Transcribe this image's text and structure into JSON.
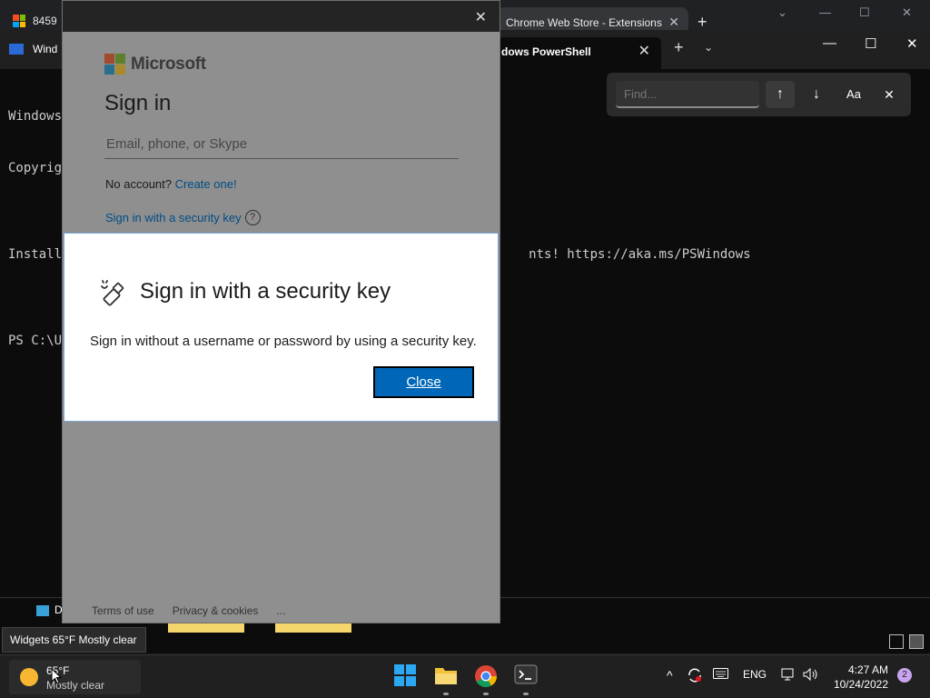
{
  "chrome": {
    "left_tab_text": "8459",
    "right_tab_title": "Chrome Web Store - Extensions",
    "close": "✕",
    "new_tab": "+",
    "ctl_down": "⌄",
    "ctl_min": "—",
    "ctl_max": "☐",
    "ctl_close": "✕"
  },
  "terminal": {
    "left_tab": "Wind",
    "active_tab": "dows PowerShell",
    "tab_close": "✕",
    "new_tab": "+",
    "dropdown": "⌄",
    "win_min": "—",
    "win_max": "☐",
    "win_close": "✕",
    "lines": [
      "Windows",
      "Copyrig",
      "",
      "Install                                                             nts! https://aka.ms/PSWindows",
      "",
      "PS C:\\U"
    ],
    "find": {
      "placeholder": "Find...",
      "up": "↑",
      "down": "↓",
      "case": "Aa",
      "close": "✕"
    },
    "bottom_item": "D"
  },
  "signin": {
    "brand": "Microsoft",
    "heading": "Sign in",
    "email_placeholder": "Email, phone, or Skype",
    "no_account_text": "No account?",
    "create_link": "Create one!",
    "security_key_link": "Sign in with a security key",
    "help": "?",
    "close": "✕",
    "footer": {
      "terms": "Terms of use",
      "privacy": "Privacy & cookies",
      "more": "..."
    }
  },
  "modal": {
    "title": "Sign in with a security key",
    "text": "Sign in without a username or password by using a security key.",
    "button": "Close"
  },
  "widget_tooltip": "Widgets 65°F Mostly clear",
  "taskbar": {
    "temperature": "65°F",
    "condition": "Mostly clear",
    "language": "ENG",
    "time": "4:27 AM",
    "date": "10/24/2022",
    "notifications": "2",
    "chevron": "^"
  },
  "colors": {
    "ms_red": "#f25022",
    "ms_green": "#7fba00",
    "ms_blue": "#00a4ef",
    "ms_yellow": "#ffb900",
    "accent_button": "#0067b8"
  }
}
